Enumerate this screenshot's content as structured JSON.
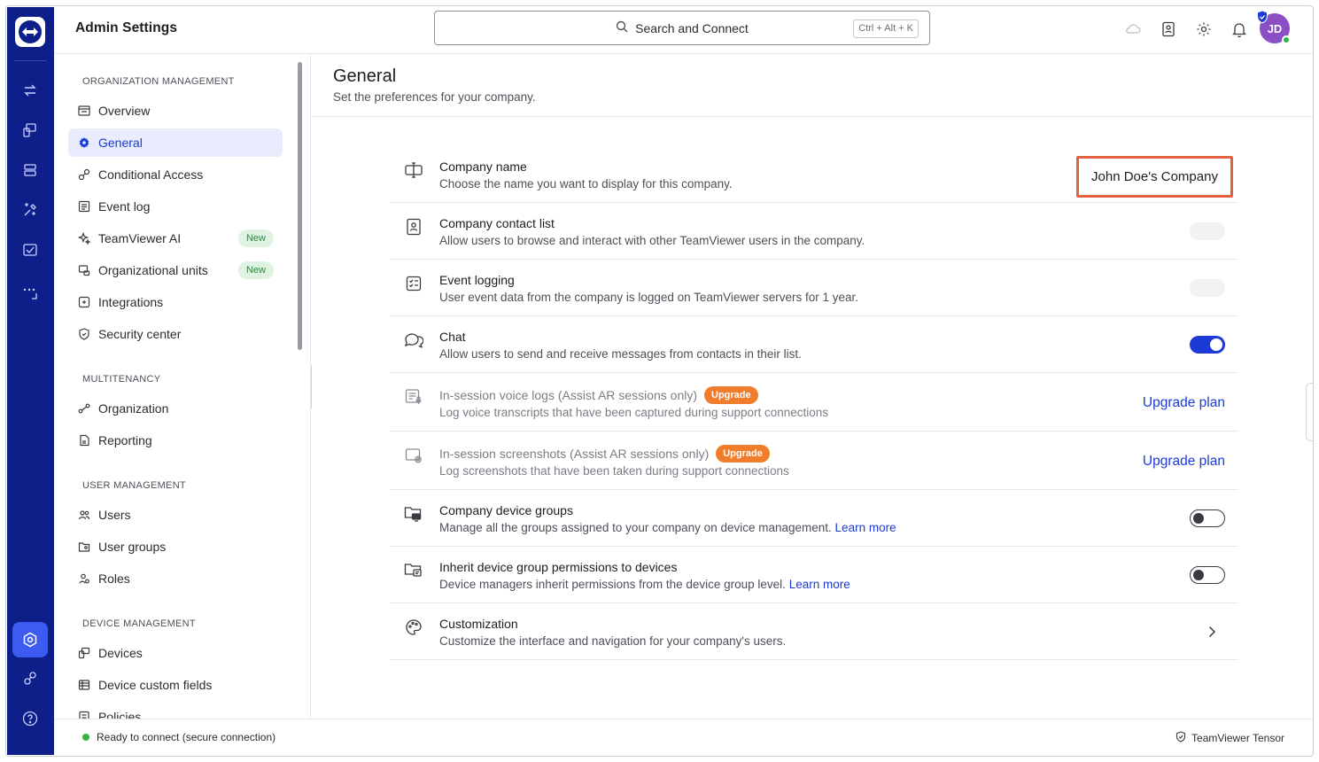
{
  "header": {
    "app_title": "Admin Settings",
    "search_placeholder": "Search and Connect",
    "search_shortcut": "Ctrl + Alt + K",
    "avatar_initials": "JD"
  },
  "sidebar": {
    "sections": [
      {
        "title": "ORGANIZATION MANAGEMENT"
      },
      {
        "title": "MULTITENANCY"
      },
      {
        "title": "USER MANAGEMENT"
      },
      {
        "title": "DEVICE MANAGEMENT"
      }
    ],
    "items": [
      {
        "label": "Overview",
        "icon": "overview-icon"
      },
      {
        "label": "General",
        "icon": "gear-icon",
        "active": true
      },
      {
        "label": "Conditional Access",
        "icon": "conditional-access-icon"
      },
      {
        "label": "Event log",
        "icon": "event-log-icon"
      },
      {
        "label": "TeamViewer AI",
        "icon": "sparkle-icon",
        "badge": "New"
      },
      {
        "label": "Organizational units",
        "icon": "org-units-icon",
        "badge": "New"
      },
      {
        "label": "Integrations",
        "icon": "integrations-icon"
      },
      {
        "label": "Security center",
        "icon": "shield-icon"
      },
      {
        "label": "Organization",
        "icon": "organization-icon"
      },
      {
        "label": "Reporting",
        "icon": "reporting-icon"
      },
      {
        "label": "Users",
        "icon": "users-icon"
      },
      {
        "label": "User groups",
        "icon": "user-groups-icon"
      },
      {
        "label": "Roles",
        "icon": "roles-icon"
      },
      {
        "label": "Devices",
        "icon": "devices-icon"
      },
      {
        "label": "Device custom fields",
        "icon": "custom-fields-icon"
      },
      {
        "label": "Policies",
        "icon": "policies-icon"
      }
    ]
  },
  "main": {
    "title": "General",
    "subtitle": "Set the preferences for your company.",
    "settings": [
      {
        "title": "Company name",
        "desc": "Choose the name you want to display for this company.",
        "value": "John Doe's Company"
      },
      {
        "title": "Company contact list",
        "desc": "Allow users to browse and interact with other TeamViewer users in the company.",
        "toggle": "loading"
      },
      {
        "title": "Event logging",
        "desc": "User event data from the company is logged on TeamViewer servers for 1 year.",
        "toggle": "loading"
      },
      {
        "title": "Chat",
        "desc": "Allow users to send and receive messages from contacts in their list.",
        "toggle": "on"
      },
      {
        "title": "In-session voice logs (Assist AR sessions only)",
        "badge": "Upgrade",
        "desc": "Log voice transcripts that have been captured during support connections",
        "action": "Upgrade plan"
      },
      {
        "title": "In-session screenshots (Assist AR sessions only)",
        "badge": "Upgrade",
        "desc": "Log screenshots that have been taken during support connections",
        "action": "Upgrade plan"
      },
      {
        "title": "Company device groups",
        "desc": "Manage all the groups assigned to your company on device management.",
        "link": "Learn more",
        "toggle": "off"
      },
      {
        "title": "Inherit device group permissions to devices",
        "desc": "Device managers inherit permissions from the device group level.",
        "link": "Learn more",
        "toggle": "off"
      },
      {
        "title": "Customization",
        "desc": "Customize the interface and navigation for your company's users."
      }
    ]
  },
  "footer": {
    "status": "Ready to connect (secure connection)",
    "tensor": "TeamViewer Tensor"
  },
  "colors": {
    "rail": "#0e1f8a",
    "accent": "#1c3ad6",
    "upgrade": "#f07d2b",
    "highlight_border": "#e0623f",
    "status_green": "#2fb344"
  }
}
